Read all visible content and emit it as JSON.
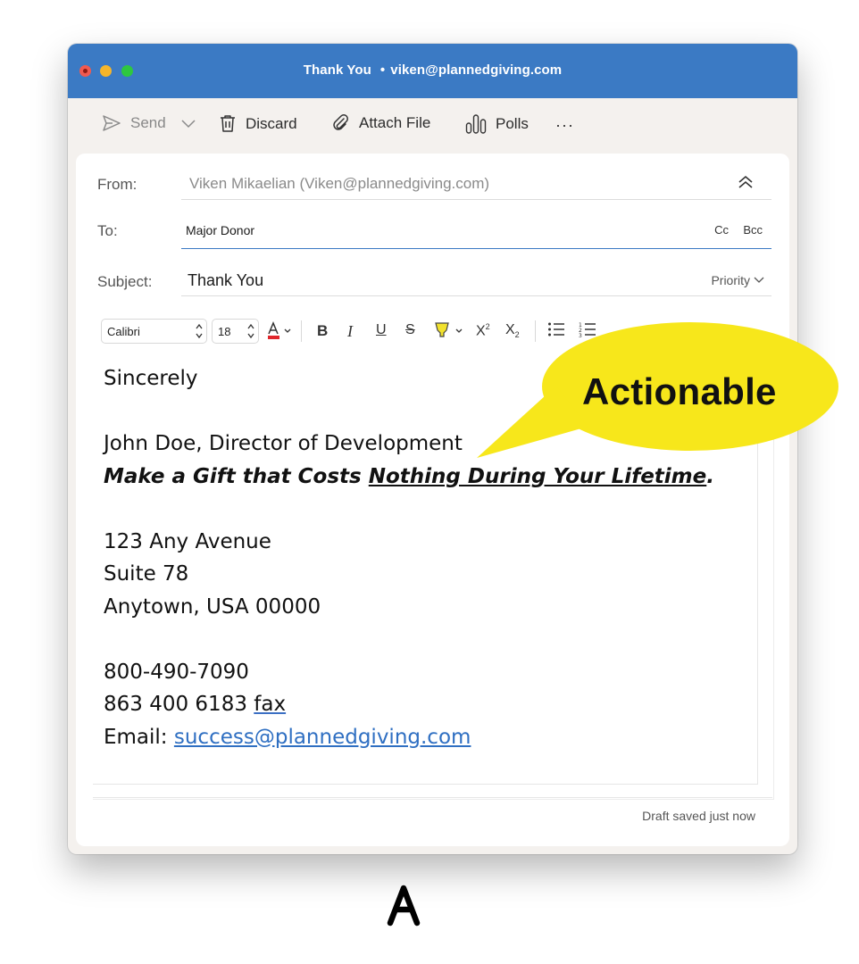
{
  "window": {
    "title": "Thank You",
    "separator": "•",
    "account": "viken@plannedgiving.com",
    "accent": "#3b7ac4"
  },
  "toolbar": {
    "send": "Send",
    "discard": "Discard",
    "attach": "Attach File",
    "polls": "Polls",
    "more": "···"
  },
  "header": {
    "from_label": "From:",
    "from_value": "Viken Mikaelian (Viken@plannedgiving.com)",
    "to_label": "To:",
    "to_value": "Major Donor",
    "cc": "Cc",
    "bcc": "Bcc",
    "subject_label": "Subject:",
    "subject_value": "Thank You",
    "priority": "Priority"
  },
  "format": {
    "font": "Calibri",
    "size": "18",
    "font_color": "#e0262b",
    "highlight_color": "#f2e22e",
    "superscript_mark": "2",
    "subscript_mark": "2"
  },
  "signature": {
    "closing": "Sincerely",
    "name_line": "John Doe, Director of Development",
    "tagline_prefix": "Make a Gift that Costs ",
    "tagline_underlined": "Nothing During Your Lifetime",
    "tagline_suffix": ".",
    "address1": "123 Any Avenue",
    "address2": "Suite 78",
    "address3": "Anytown, USA 00000",
    "phone": "800-490-7090",
    "fax_number": "863 400 6183 ",
    "fax_label": "fax",
    "email_label": "Email: ",
    "email": "success@plannedgiving.com"
  },
  "status": "Draft saved just now",
  "annotation": {
    "text": "Actionable",
    "color": "#f7e71b"
  },
  "caption": "A"
}
